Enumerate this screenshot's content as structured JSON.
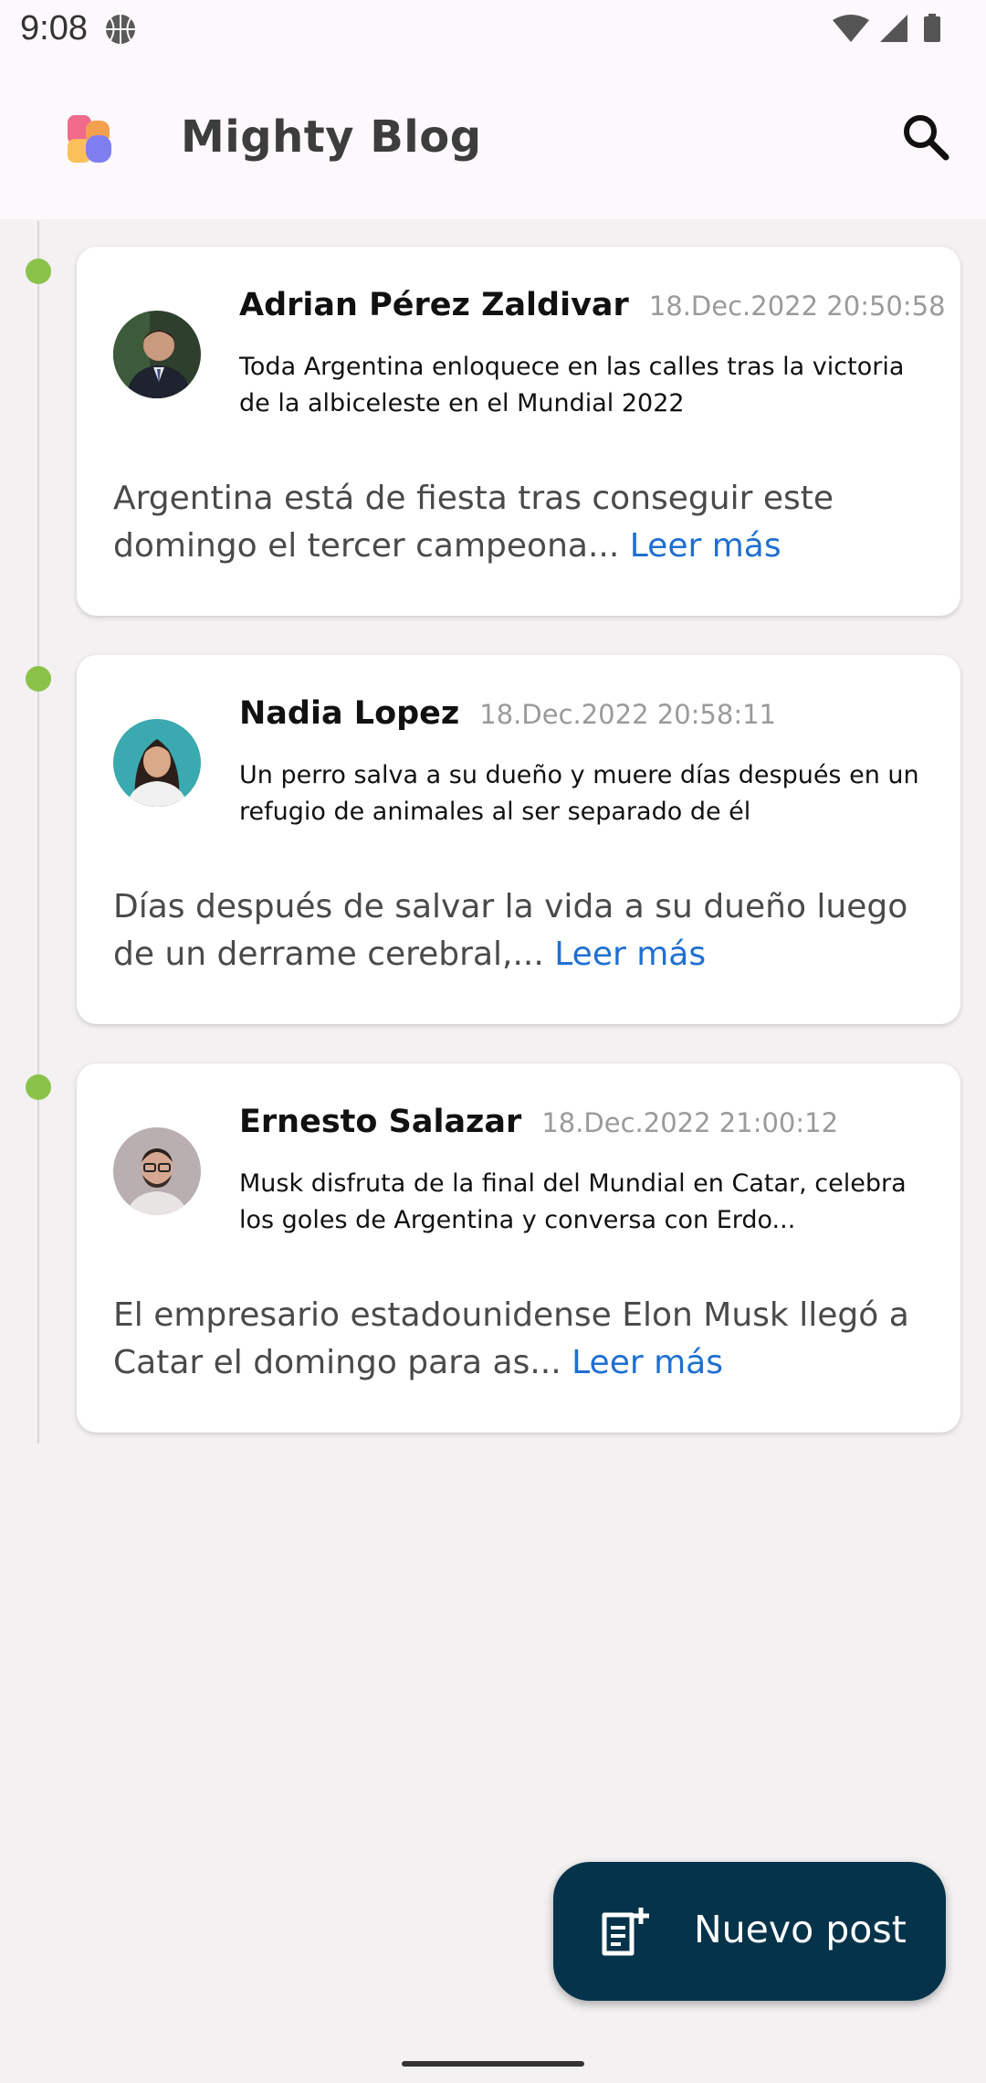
{
  "status_bar": {
    "time": "9:08"
  },
  "app_bar": {
    "title": "Mighty Blog",
    "search_icon": "search-icon"
  },
  "timeline": {
    "dot_color": "#8bc34a"
  },
  "posts": [
    {
      "author": "Adrian Pérez Zaldivar",
      "date": "18.Dec.2022 20:50:58",
      "headline": "Toda Argentina enloquece en las calles tras la victoria de la albiceleste en el Mundial 2022",
      "excerpt": "Argentina está de fiesta tras conseguir este domingo el tercer campeona...",
      "read_more": "Leer más"
    },
    {
      "author": "Nadia Lopez",
      "date": "18.Dec.2022 20:58:11",
      "headline": "Un perro salva a su dueño y muere días después en un refugio de animales al ser separado de él",
      "excerpt": "Días después de salvar la vida a su dueño luego de un derrame cerebral,...",
      "read_more": "Leer más"
    },
    {
      "author": "Ernesto Salazar",
      "date": "18.Dec.2022 21:00:12",
      "headline": "Musk disfruta de la final del Mundial en Catar, celebra los goles de Argentina y conversa con Erdo...",
      "excerpt": "El empresario estadounidense Elon Musk llegó a Catar el domingo para as...",
      "read_more": "Leer más"
    }
  ],
  "fab": {
    "label": "Nuevo post",
    "icon": "new-post-icon",
    "background": "#05334a"
  },
  "colors": {
    "link": "#1f6fd1",
    "background": "#f3f1f2"
  }
}
